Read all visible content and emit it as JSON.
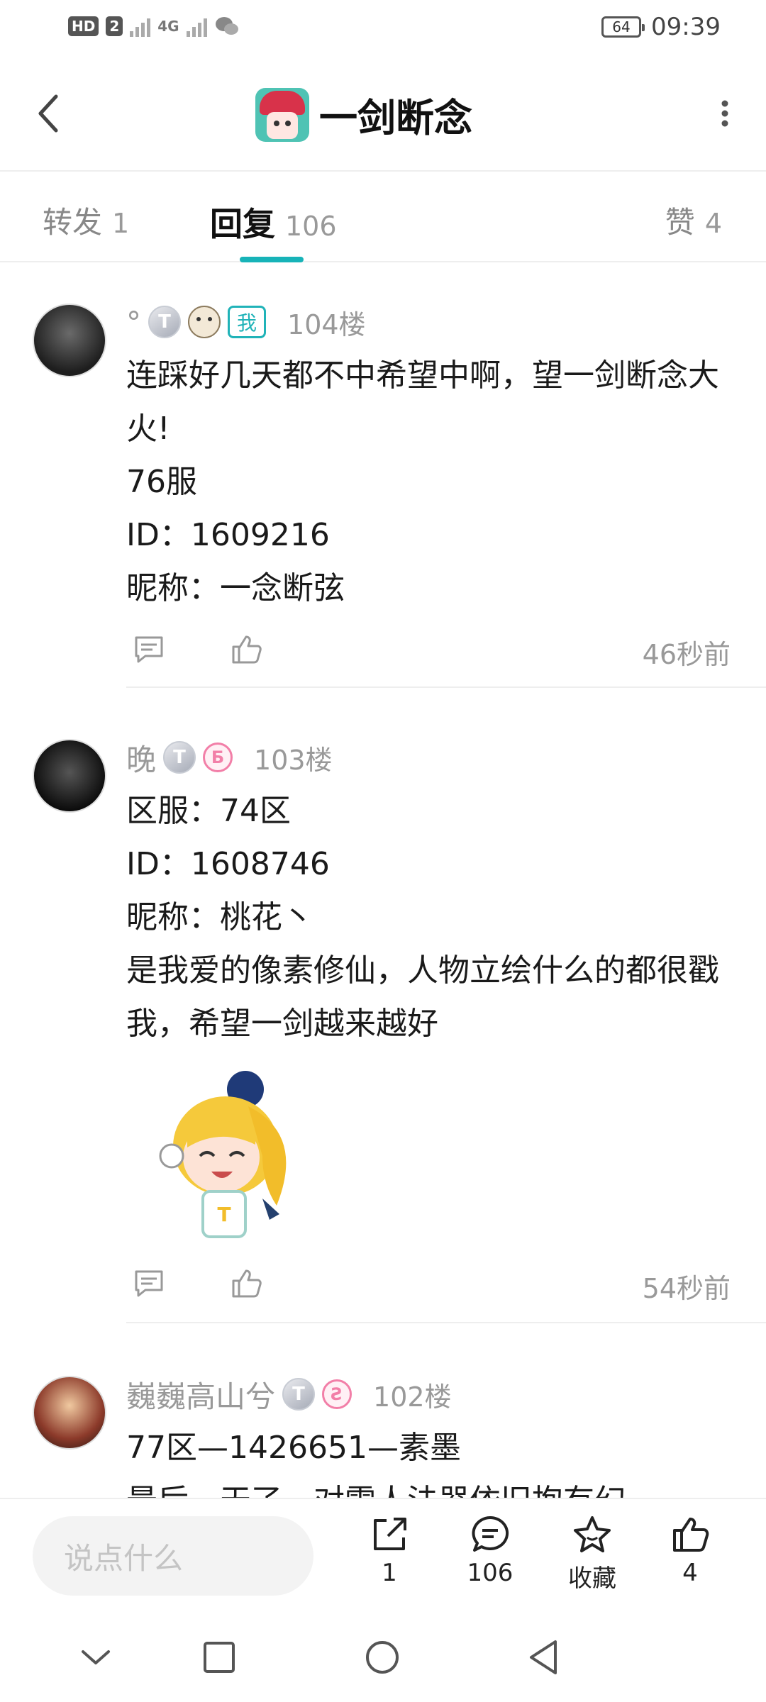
{
  "status_bar": {
    "hd_label": "HD",
    "sim_label": "2",
    "network": "4G",
    "battery": "64",
    "time": "09:39"
  },
  "header": {
    "title": "一剑断念"
  },
  "tabs": [
    {
      "label": "转发",
      "count": "1"
    },
    {
      "label": "回复",
      "count": "106"
    },
    {
      "label": "赞",
      "count": "4"
    }
  ],
  "comments": [
    {
      "username": "°",
      "level": "T",
      "me_tag": "我",
      "floor": "104楼",
      "lines": [
        "连踩好几天都不中希望中啊，望一剑断念大火!",
        "76服",
        "ID：1609216",
        "昵称：一念断弦"
      ],
      "time": "46秒前"
    },
    {
      "username": "晚",
      "level": "T",
      "pink_badge": "Б",
      "floor": "103楼",
      "lines": [
        "区服：74区",
        "ID：1608746",
        "昵称：桃花丶",
        "是我爱的像素修仙，人物立绘什么的都很戳我，希望一剑越来越好"
      ],
      "time": "54秒前"
    },
    {
      "username": "巍巍高山兮",
      "level": "T",
      "pink_badge": "Ƨ",
      "floor": "102楼",
      "lines": [
        "77区—1426651—素墨",
        "最后一天了，对雷人法器依旧抱有幻"
      ]
    }
  ],
  "bottom_bar": {
    "input_placeholder": "说点什么",
    "share_count": "1",
    "comment_count": "106",
    "fav_label": "收藏",
    "like_count": "4"
  },
  "colors": {
    "accent": "#17b3b8",
    "muted": "#999999",
    "pink": "#f27fa8"
  }
}
